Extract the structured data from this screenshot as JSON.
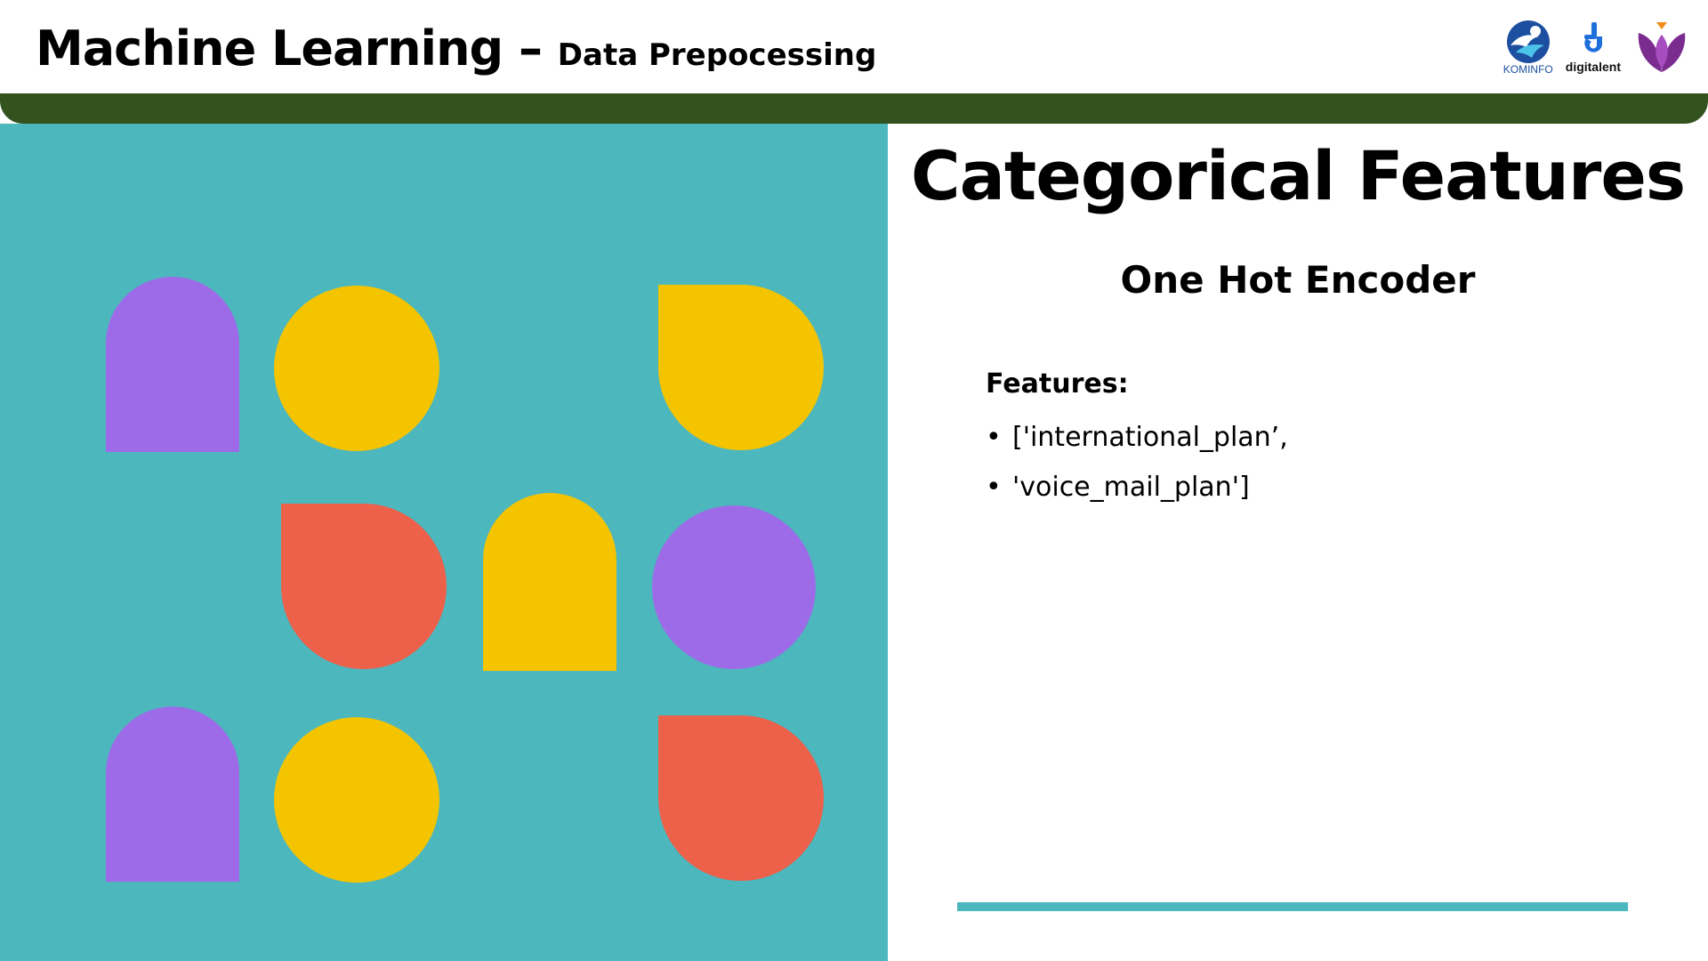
{
  "header": {
    "title": "Machine Learning –",
    "subtitle": "Data Prepocessing",
    "logos": [
      {
        "name": "kominfo-logo",
        "caption": "KOMINFO"
      },
      {
        "name": "digitalent-logo",
        "caption": "digitalent"
      },
      {
        "name": "purple-flower-logo",
        "caption": ""
      }
    ]
  },
  "content": {
    "heading": "Categorical Features",
    "subheading": "One Hot Encoder",
    "features_label": "Features:",
    "features": [
      "['international_plan’,",
      "'voice_mail_plan']"
    ]
  },
  "colors": {
    "header_bar": "#33521d",
    "panel": "#4cb7bd",
    "purple": "#9e6be8",
    "yellow": "#f5c400",
    "coral": "#ed604a",
    "rule": "#4cb7bd"
  }
}
